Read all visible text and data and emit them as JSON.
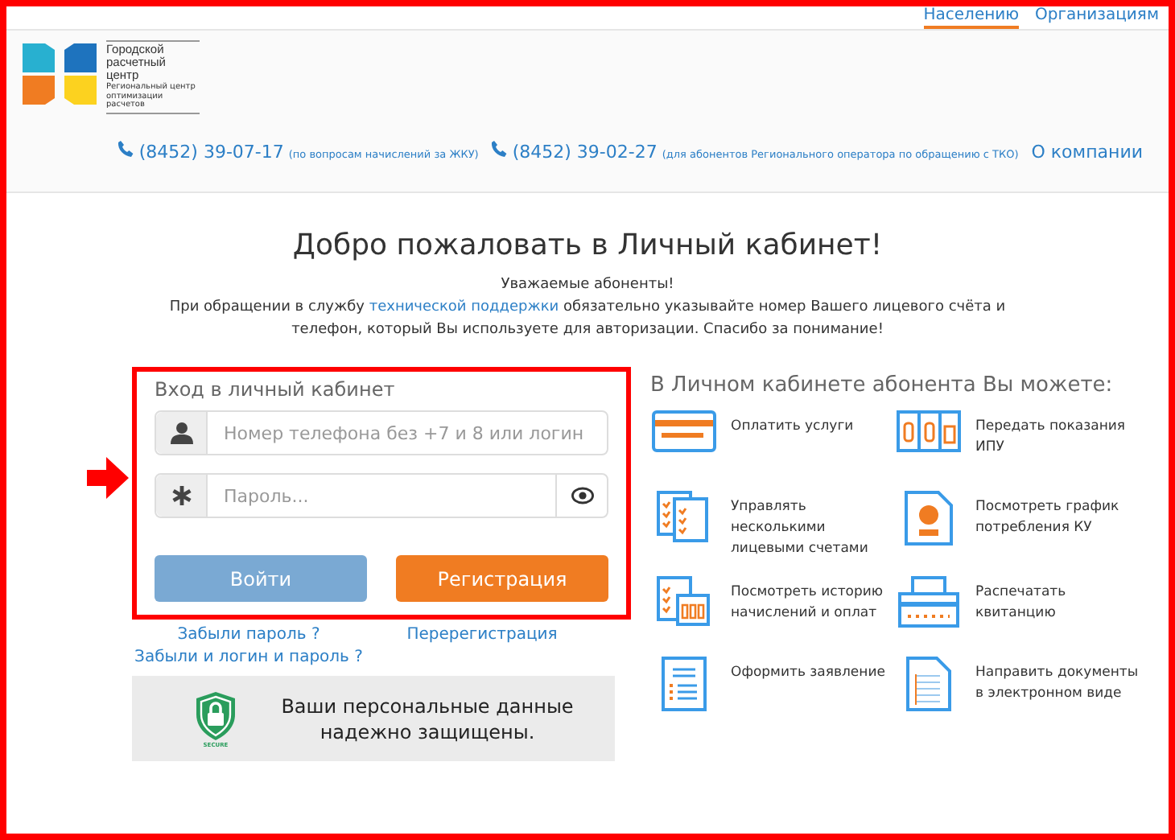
{
  "nav": [
    {
      "label": "Населению",
      "selected": true
    },
    {
      "label": "Организациям",
      "selected": false
    }
  ],
  "logo": {
    "title": "Городской расчетный центр",
    "subtitle": "Региональный центр оптимизации расчетов"
  },
  "phones": [
    {
      "number": "(8452) 39-07-17",
      "note": "(по вопросам начислений за ЖКУ)"
    },
    {
      "number": "(8452) 39-02-27",
      "note": "(для абонентов Регионального оператора по обращению с ТКО)"
    }
  ],
  "about_link": "О компании",
  "heading": "Добро пожаловать в Личный кабинет!",
  "notice": {
    "greeting": "Уважаемые абоненты!",
    "before": "При обращении в службу ",
    "link": "технической поддержки",
    "after": " обязательно указывайте номер Вашего лицевого счёта и телефон, который Вы используете для авторизации. Спасибо за понимание!"
  },
  "login": {
    "title": "Вход в личный кабинет",
    "login_placeholder": "Номер телефона без +7 и 8 или логин",
    "password_placeholder": "Пароль...",
    "login_button": "Войти",
    "register_button": "Регистрация",
    "forgot_password": "Забыли пароль ?",
    "reregister": "Перерегистрация",
    "forgot_both": "Забыли и логин и пароль ?"
  },
  "security": {
    "text": "Ваши персональные данные надежно защищены.",
    "badge": "SECURE"
  },
  "features": {
    "title": "В Личном кабинете абонента Вы можете:",
    "items": [
      {
        "kind": "card",
        "label": "Оплатить услуги"
      },
      {
        "kind": "counter",
        "label": "Передать показания ИПУ"
      },
      {
        "kind": "accounts",
        "label": "Управлять несколькими лицевыми счетами"
      },
      {
        "kind": "chart",
        "label": "Посмотреть график потребления КУ"
      },
      {
        "kind": "history",
        "label": "Посмотреть историю начислений и оплат"
      },
      {
        "kind": "printer",
        "label": "Распечатать квитанцию"
      },
      {
        "kind": "form",
        "label": "Оформить заявление"
      },
      {
        "kind": "document",
        "label": "Направить документы в электронном виде"
      }
    ]
  }
}
